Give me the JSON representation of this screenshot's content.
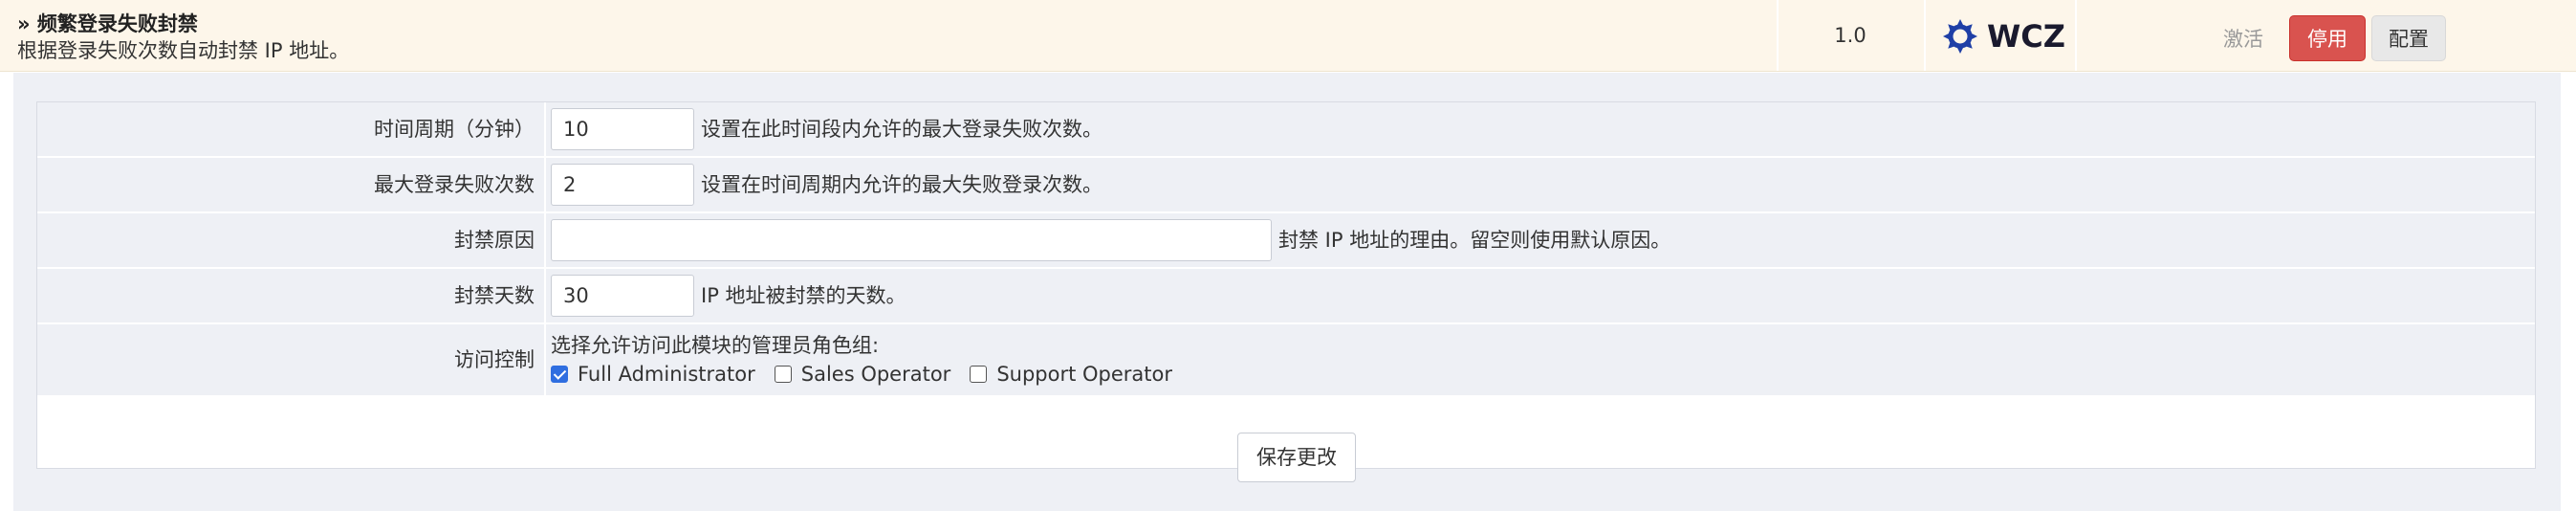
{
  "module": {
    "title": "» 频繁登录失败封禁",
    "description": "根据登录失败次数自动封禁 IP 地址。",
    "version": "1.0",
    "logo_text": "WCZ",
    "status_label": "激活",
    "disable_label": "停用",
    "config_label": "配置"
  },
  "form": {
    "rows": [
      {
        "label": "时间周期（分钟）",
        "value": "10",
        "help": "设置在此时间段内允许的最大登录失败次数。"
      },
      {
        "label": "最大登录失败次数",
        "value": "2",
        "help": "设置在时间周期内允许的最大失败登录次数。"
      },
      {
        "label": "封禁原因",
        "value": "",
        "help": "封禁 IP 地址的理由。留空则使用默认原因。"
      },
      {
        "label": "封禁天数",
        "value": "30",
        "help": "IP 地址被封禁的天数。"
      }
    ],
    "access": {
      "label": "访问控制",
      "title": "选择允许访问此模块的管理员角色组:",
      "options": [
        {
          "label": "Full Administrator",
          "checked": true
        },
        {
          "label": "Sales Operator",
          "checked": false
        },
        {
          "label": "Support Operator",
          "checked": false
        }
      ]
    },
    "save_label": "保存更改"
  },
  "colors": {
    "header_bg": "#fdf6ea",
    "panel_bg": "#eef0f5",
    "danger": "#d9534f",
    "checkbox": "#2f6ee0"
  }
}
